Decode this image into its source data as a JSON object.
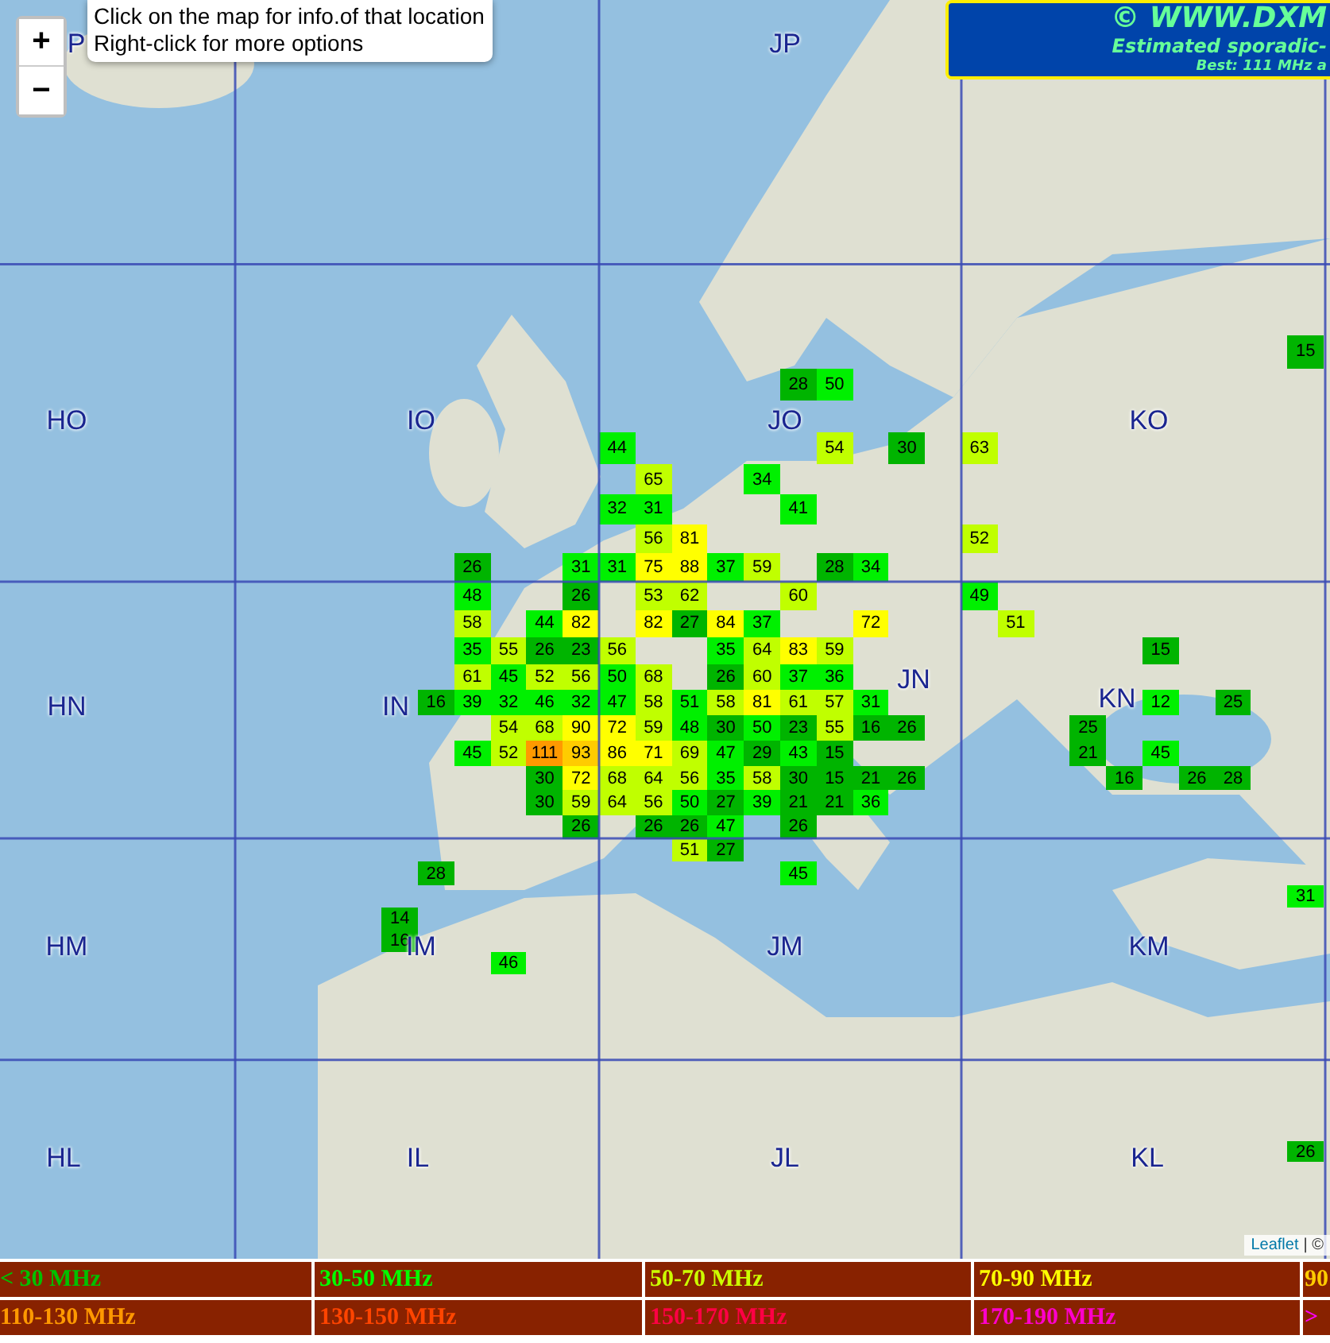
{
  "map": {
    "grid_labels": [
      {
        "text": "P"
      },
      {
        "text": "JP"
      },
      {
        "text": "HO"
      },
      {
        "text": "IO"
      },
      {
        "text": "JO"
      },
      {
        "text": "KO"
      },
      {
        "text": "HN"
      },
      {
        "text": "IN"
      },
      {
        "text": "JN"
      },
      {
        "text": "KN"
      },
      {
        "text": "HM"
      },
      {
        "text": "IM"
      },
      {
        "text": "JM"
      },
      {
        "text": "KM"
      },
      {
        "text": "HL"
      },
      {
        "text": "IL"
      },
      {
        "text": "JL"
      },
      {
        "text": "KL"
      }
    ],
    "squares": [
      {
        "value": "15",
        "color": "#00b400"
      },
      {
        "value": "28",
        "color": "#00b400"
      },
      {
        "value": "50",
        "color": "#00f000"
      },
      {
        "value": "44",
        "color": "#00f000"
      },
      {
        "value": "54",
        "color": "#c0ff00"
      },
      {
        "value": "30",
        "color": "#00b400"
      },
      {
        "value": "63",
        "color": "#c0ff00"
      },
      {
        "value": "65",
        "color": "#c0ff00"
      },
      {
        "value": "34",
        "color": "#00f000"
      },
      {
        "value": "32",
        "color": "#00f000"
      },
      {
        "value": "31",
        "color": "#00f000"
      },
      {
        "value": "41",
        "color": "#00f000"
      },
      {
        "value": "56",
        "color": "#c0ff00"
      },
      {
        "value": "81",
        "color": "#ffff00"
      },
      {
        "value": "52",
        "color": "#c0ff00"
      },
      {
        "value": "26",
        "color": "#00b400"
      },
      {
        "value": "31",
        "color": "#00f000"
      },
      {
        "value": "31",
        "color": "#00f000"
      },
      {
        "value": "75",
        "color": "#ffff00"
      },
      {
        "value": "88",
        "color": "#ffff00"
      },
      {
        "value": "37",
        "color": "#00f000"
      },
      {
        "value": "59",
        "color": "#c0ff00"
      },
      {
        "value": "28",
        "color": "#00b400"
      },
      {
        "value": "34",
        "color": "#00f000"
      },
      {
        "value": "48",
        "color": "#00f000"
      },
      {
        "value": "26",
        "color": "#00b400"
      },
      {
        "value": "53",
        "color": "#c0ff00"
      },
      {
        "value": "62",
        "color": "#c0ff00"
      },
      {
        "value": "60",
        "color": "#c0ff00"
      },
      {
        "value": "49",
        "color": "#00f000"
      },
      {
        "value": "58",
        "color": "#c0ff00"
      },
      {
        "value": "44",
        "color": "#00f000"
      },
      {
        "value": "82",
        "color": "#ffff00"
      },
      {
        "value": "82",
        "color": "#ffff00"
      },
      {
        "value": "27",
        "color": "#00b400"
      },
      {
        "value": "84",
        "color": "#ffff00"
      },
      {
        "value": "37",
        "color": "#00f000"
      },
      {
        "value": "72",
        "color": "#ffff00"
      },
      {
        "value": "51",
        "color": "#c0ff00"
      },
      {
        "value": "35",
        "color": "#00f000"
      },
      {
        "value": "55",
        "color": "#c0ff00"
      },
      {
        "value": "26",
        "color": "#00b400"
      },
      {
        "value": "23",
        "color": "#00b400"
      },
      {
        "value": "56",
        "color": "#c0ff00"
      },
      {
        "value": "35",
        "color": "#00f000"
      },
      {
        "value": "64",
        "color": "#c0ff00"
      },
      {
        "value": "83",
        "color": "#ffff00"
      },
      {
        "value": "59",
        "color": "#c0ff00"
      },
      {
        "value": "15",
        "color": "#00b400"
      },
      {
        "value": "61",
        "color": "#c0ff00"
      },
      {
        "value": "45",
        "color": "#00f000"
      },
      {
        "value": "52",
        "color": "#c0ff00"
      },
      {
        "value": "56",
        "color": "#c0ff00"
      },
      {
        "value": "50",
        "color": "#00f000"
      },
      {
        "value": "68",
        "color": "#c0ff00"
      },
      {
        "value": "26",
        "color": "#00b400"
      },
      {
        "value": "60",
        "color": "#c0ff00"
      },
      {
        "value": "37",
        "color": "#00f000"
      },
      {
        "value": "36",
        "color": "#00f000"
      },
      {
        "value": "16",
        "color": "#00b400"
      },
      {
        "value": "39",
        "color": "#00f000"
      },
      {
        "value": "32",
        "color": "#00f000"
      },
      {
        "value": "46",
        "color": "#00f000"
      },
      {
        "value": "32",
        "color": "#00f000"
      },
      {
        "value": "47",
        "color": "#00f000"
      },
      {
        "value": "58",
        "color": "#c0ff00"
      },
      {
        "value": "51",
        "color": "#00f000"
      },
      {
        "value": "58",
        "color": "#c0ff00"
      },
      {
        "value": "81",
        "color": "#ffff00"
      },
      {
        "value": "61",
        "color": "#c0ff00"
      },
      {
        "value": "57",
        "color": "#c0ff00"
      },
      {
        "value": "31",
        "color": "#00f000"
      },
      {
        "value": "12",
        "color": "#00f000"
      },
      {
        "value": "25",
        "color": "#00b400"
      },
      {
        "value": "54",
        "color": "#c0ff00"
      },
      {
        "value": "68",
        "color": "#c0ff00"
      },
      {
        "value": "90",
        "color": "#ffff00"
      },
      {
        "value": "72",
        "color": "#ffff00"
      },
      {
        "value": "59",
        "color": "#c0ff00"
      },
      {
        "value": "48",
        "color": "#00f000"
      },
      {
        "value": "30",
        "color": "#00b400"
      },
      {
        "value": "50",
        "color": "#00f000"
      },
      {
        "value": "23",
        "color": "#00b400"
      },
      {
        "value": "55",
        "color": "#c0ff00"
      },
      {
        "value": "16",
        "color": "#00b400"
      },
      {
        "value": "26",
        "color": "#00b400"
      },
      {
        "value": "25",
        "color": "#00b400"
      },
      {
        "value": "45",
        "color": "#00f000"
      },
      {
        "value": "52",
        "color": "#c0ff00"
      },
      {
        "value": "111",
        "color": "#ff9900"
      },
      {
        "value": "93",
        "color": "#ffcc00"
      },
      {
        "value": "86",
        "color": "#ffff00"
      },
      {
        "value": "71",
        "color": "#ffff00"
      },
      {
        "value": "69",
        "color": "#c0ff00"
      },
      {
        "value": "47",
        "color": "#00f000"
      },
      {
        "value": "29",
        "color": "#00b400"
      },
      {
        "value": "43",
        "color": "#00f000"
      },
      {
        "value": "15",
        "color": "#00b400"
      },
      {
        "value": "21",
        "color": "#00b400"
      },
      {
        "value": "45",
        "color": "#00f000"
      },
      {
        "value": "30",
        "color": "#00b400"
      },
      {
        "value": "72",
        "color": "#ffff00"
      },
      {
        "value": "68",
        "color": "#c0ff00"
      },
      {
        "value": "64",
        "color": "#c0ff00"
      },
      {
        "value": "56",
        "color": "#c0ff00"
      },
      {
        "value": "35",
        "color": "#00f000"
      },
      {
        "value": "58",
        "color": "#c0ff00"
      },
      {
        "value": "30",
        "color": "#00b400"
      },
      {
        "value": "15",
        "color": "#00b400"
      },
      {
        "value": "21",
        "color": "#00b400"
      },
      {
        "value": "26",
        "color": "#00b400"
      },
      {
        "value": "16",
        "color": "#00b400"
      },
      {
        "value": "26",
        "color": "#00b400"
      },
      {
        "value": "28",
        "color": "#00b400"
      },
      {
        "value": "30",
        "color": "#00b400"
      },
      {
        "value": "59",
        "color": "#c0ff00"
      },
      {
        "value": "64",
        "color": "#c0ff00"
      },
      {
        "value": "56",
        "color": "#c0ff00"
      },
      {
        "value": "50",
        "color": "#00f000"
      },
      {
        "value": "27",
        "color": "#00b400"
      },
      {
        "value": "39",
        "color": "#00f000"
      },
      {
        "value": "21",
        "color": "#00b400"
      },
      {
        "value": "21",
        "color": "#00b400"
      },
      {
        "value": "36",
        "color": "#00f000"
      },
      {
        "value": "26",
        "color": "#00b400"
      },
      {
        "value": "26",
        "color": "#00b400"
      },
      {
        "value": "26",
        "color": "#00b400"
      },
      {
        "value": "47",
        "color": "#00f000"
      },
      {
        "value": "26",
        "color": "#00b400"
      },
      {
        "value": "51",
        "color": "#c0ff00"
      },
      {
        "value": "27",
        "color": "#00b400"
      },
      {
        "value": "28",
        "color": "#00b400"
      },
      {
        "value": "45",
        "color": "#00f000"
      },
      {
        "value": "31",
        "color": "#00f000"
      },
      {
        "value": "14",
        "color": "#00b400"
      },
      {
        "value": "16",
        "color": "#00b400"
      },
      {
        "value": "46",
        "color": "#00f000"
      },
      {
        "value": "26",
        "color": "#00b400"
      }
    ],
    "zoom_controls": [
      "+",
      "−"
    ],
    "info_box": {
      "lines": [
        "Click on the map for info.of that location",
        "Right-click for more options"
      ]
    },
    "banner": {
      "title": "© WWW.DXM",
      "subtitle": "Estimated sporadic-",
      "best": "Best: 111 MHz a"
    },
    "attribution": {
      "link": "Leaflet",
      "rest": "| ©"
    }
  },
  "legend": [
    {
      "label": "< 30 MHz",
      "color": "#00c000"
    },
    {
      "label": "30-50 MHz",
      "color": "#00ff00"
    },
    {
      "label": "50-70 MHz",
      "color": "#ccff00"
    },
    {
      "label": "70-90 MHz",
      "color": "#ffff00"
    },
    {
      "label": "90",
      "color": "#ffcc00"
    },
    {
      "label": "110-130 MHz",
      "color": "#ff9900"
    },
    {
      "label": "130-150 MHz",
      "color": "#ff4400"
    },
    {
      "label": "150-170 MHz",
      "color": "#ff0044"
    },
    {
      "label": "170-190 MHz",
      "color": "#ff00cc"
    },
    {
      "label": ">",
      "color": "#ff00ff"
    }
  ]
}
